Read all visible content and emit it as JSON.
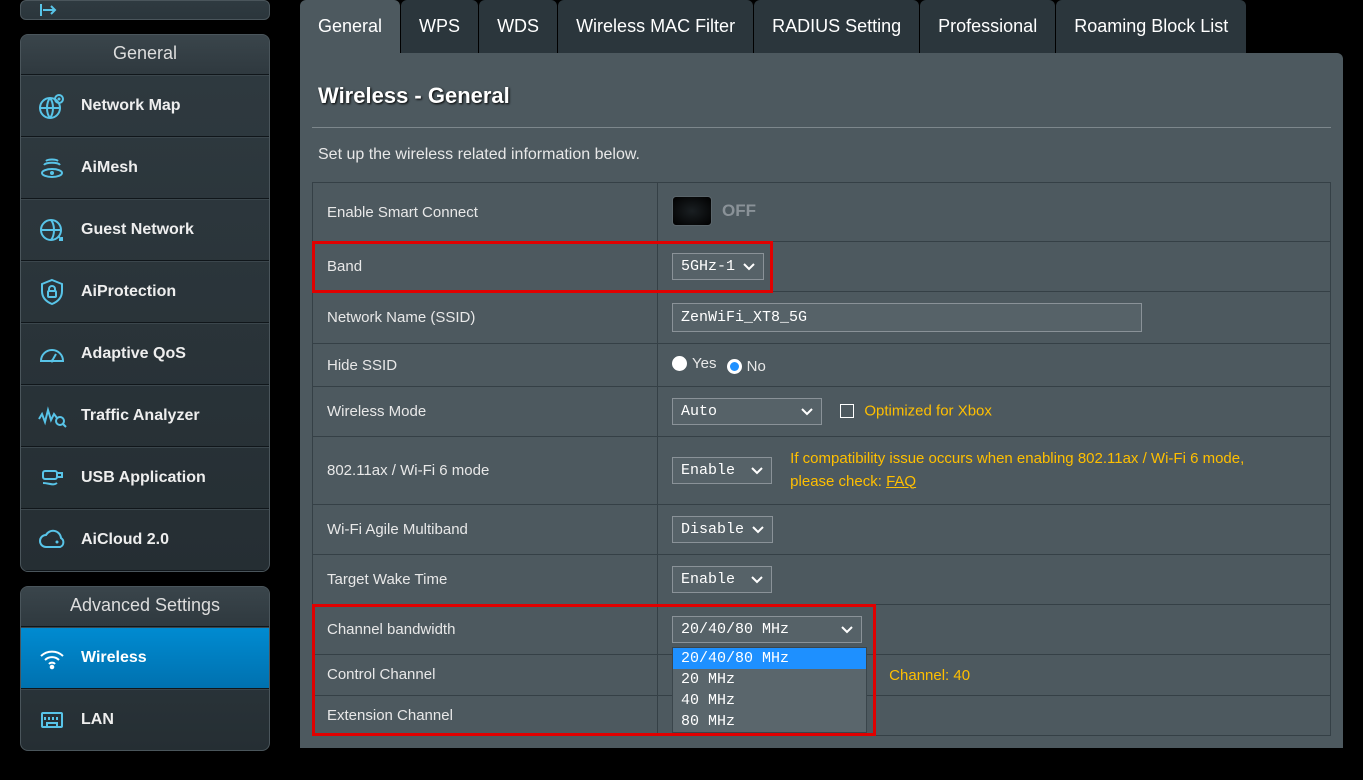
{
  "sidebar": {
    "general_header": "General",
    "general_items": [
      {
        "label": "Network Map"
      },
      {
        "label": "AiMesh"
      },
      {
        "label": "Guest Network"
      },
      {
        "label": "AiProtection"
      },
      {
        "label": "Adaptive QoS"
      },
      {
        "label": "Traffic Analyzer"
      },
      {
        "label": "USB Application"
      },
      {
        "label": "AiCloud 2.0"
      }
    ],
    "advanced_header": "Advanced Settings",
    "advanced_items": [
      {
        "label": "Wireless"
      },
      {
        "label": "LAN"
      }
    ]
  },
  "tabs": [
    "General",
    "WPS",
    "WDS",
    "Wireless MAC Filter",
    "RADIUS Setting",
    "Professional",
    "Roaming Block List"
  ],
  "panel": {
    "title": "Wireless - General",
    "desc": "Set up the wireless related information below."
  },
  "settings": {
    "smart_connect": {
      "label": "Enable Smart Connect",
      "state": "OFF"
    },
    "band": {
      "label": "Band",
      "value": "5GHz-1"
    },
    "ssid": {
      "label": "Network Name (SSID)",
      "value": "ZenWiFi_XT8_5G"
    },
    "hide_ssid": {
      "label": "Hide SSID",
      "yes": "Yes",
      "no": "No",
      "value": "No"
    },
    "wmode": {
      "label": "Wireless Mode",
      "value": "Auto",
      "xbox": "Optimized for Xbox"
    },
    "ax": {
      "label": "802.11ax / Wi-Fi 6 mode",
      "value": "Enable",
      "hint_pre": "If compatibility issue occurs when enabling 802.11ax / Wi-Fi 6 mode, please check: ",
      "hint_link": "FAQ"
    },
    "agile": {
      "label": "Wi-Fi Agile Multiband",
      "value": "Disable"
    },
    "twt": {
      "label": "Target Wake Time",
      "value": "Enable"
    },
    "cbw": {
      "label": "Channel bandwidth",
      "value": "20/40/80 MHz",
      "options": [
        "20/40/80 MHz",
        "20 MHz",
        "40 MHz",
        "80 MHz"
      ]
    },
    "ctrl": {
      "label": "Control Channel",
      "info": "Channel: 40"
    },
    "ext": {
      "label": "Extension Channel"
    }
  }
}
